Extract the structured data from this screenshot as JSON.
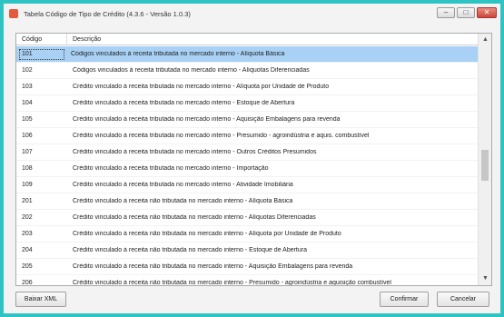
{
  "window": {
    "title": "Tabela Código de Tipo de Crédito (4.3.6 - Versão 1.0.3)"
  },
  "win_buttons": {
    "minimize": "–",
    "maximize": "□",
    "close": "✕"
  },
  "grid": {
    "headers": [
      "Código",
      "Descrição"
    ],
    "rows": [
      {
        "code": "101",
        "desc": "Códigos vinculados à receita tributada no mercado interno - Alíquota Básica"
      },
      {
        "code": "102",
        "desc": "Códigos vinculados à receita tributada no mercado interno - Alíquotas Diferenciadas"
      },
      {
        "code": "103",
        "desc": "Crédito vinculado à receita tributada no mercado interno - Alíquota por Unidade de Produto"
      },
      {
        "code": "104",
        "desc": "Crédito vinculado à receita tributada no mercado interno - Estoque de Abertura"
      },
      {
        "code": "105",
        "desc": "Crédito vinculado à receita tributada no mercado interno - Aquisição Embalagens para revenda"
      },
      {
        "code": "106",
        "desc": "Crédito vinculado à receita tributada no mercado interno - Presumido - agroindústria e aquis. combustível"
      },
      {
        "code": "107",
        "desc": "Crédito vinculado à receita tributada no mercado interno - Outros Créditos Presumidos"
      },
      {
        "code": "108",
        "desc": "Crédito vinculado à receita tributada no mercado interno - Importação"
      },
      {
        "code": "109",
        "desc": "Crédito vinculado à receita tributada no mercado interno - Atividade Imobiliária"
      },
      {
        "code": "201",
        "desc": "Crédito vinculado à receita não tributada no mercado interno - Alíquota Básica"
      },
      {
        "code": "202",
        "desc": "Crédito vinculado à receita não tributada no mercado interno - Alíquotas Diferenciadas"
      },
      {
        "code": "203",
        "desc": "Crédito vinculado à receita não tributada no mercado interno - Alíquota por Unidade de Produto"
      },
      {
        "code": "204",
        "desc": "Crédito vinculado à receita não tributada no mercado interno - Estoque de Abertura"
      },
      {
        "code": "205",
        "desc": "Crédito vinculado à receita não tributada no mercado interno - Aquisição Embalagens para revenda"
      },
      {
        "code": "206",
        "desc": "Crédito vinculado à receita não tributada no mercado interno - Presumido - agroindústria e aquisição combustível"
      }
    ]
  },
  "buttons": {
    "baixar_xml": "Baixar XML",
    "confirmar": "Confirmar",
    "cancelar": "Cancelar"
  },
  "scrollbar": {
    "up": "▲",
    "down": "▼"
  }
}
